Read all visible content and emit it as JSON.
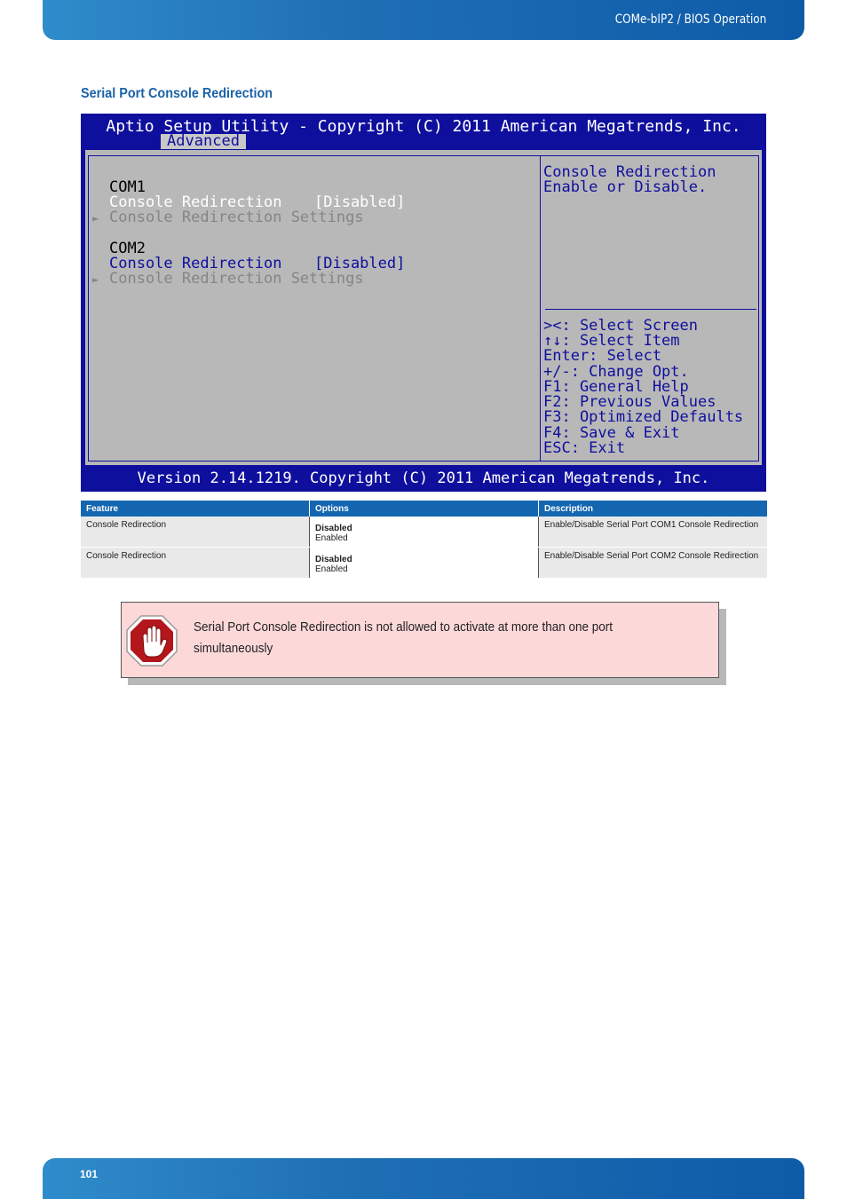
{
  "header": {
    "title": "COMe-bIP2 / BIOS Operation"
  },
  "section": {
    "title": "Serial Port Console Redirection"
  },
  "bios": {
    "title": "Aptio Setup Utility - Copyright (C) 2011 American Megatrends, Inc.",
    "tab": "Advanced",
    "lines": [
      "COM1",
      "Console Redirection",
      "[Disabled]",
      "Console Redirection Settings",
      "COM2",
      "Console Redirection",
      "[Disabled]",
      "Console Redirection Settings"
    ],
    "arrow": "►",
    "help": [
      "Console Redirection",
      "Enable or Disable."
    ],
    "keys": [
      "><: Select Screen",
      "↑↓: Select Item",
      "Enter: Select",
      "+/-: Change Opt.",
      "F1: General Help",
      "F2: Previous Values",
      "F3: Optimized Defaults",
      "F4: Save & Exit",
      "ESC: Exit"
    ],
    "footer": "Version 2.14.1219. Copyright (C) 2011 American Megatrends, Inc.",
    "colors": {
      "background": "#0f0f9e",
      "panel": "#b8b8b8"
    }
  },
  "table": {
    "headers": [
      "Feature",
      "Options",
      "Description"
    ],
    "rows": [
      {
        "feature": "Console Redirection",
        "option_default": "Disabled",
        "option_other": "Enabled",
        "description": "Enable/Disable Serial Port COM1 Console Redirection"
      },
      {
        "feature": "Console Redirection",
        "option_default": "Disabled",
        "option_other": "Enabled",
        "description": "Enable/Disable Serial Port COM2 Console Redirection"
      }
    ]
  },
  "note": {
    "icon": "stop-hand-icon",
    "text": "Serial Port Console Redirection is not allowed to activate at more than one port simultaneously"
  },
  "footer": {
    "page_number": "101"
  }
}
